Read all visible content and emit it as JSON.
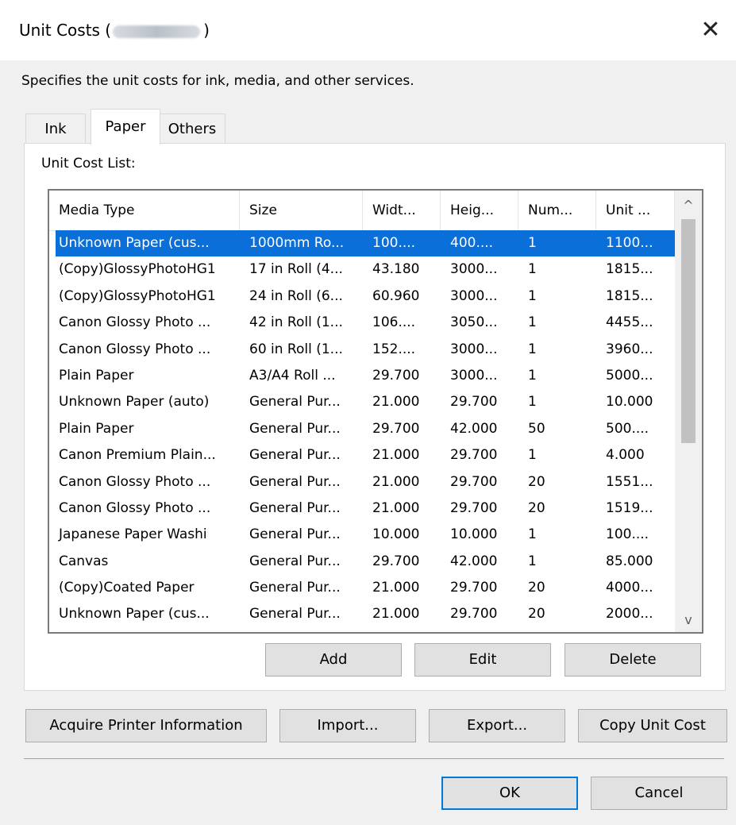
{
  "window": {
    "title_prefix": "Unit Costs (",
    "title_suffix": ")",
    "close_glyph": "✕"
  },
  "description": "Specifies the unit costs for ink, media, and other services.",
  "tabs": [
    {
      "label": "Ink",
      "active": false
    },
    {
      "label": "Paper",
      "active": true
    },
    {
      "label": "Others",
      "active": false
    }
  ],
  "list": {
    "label": "Unit Cost List:",
    "columns": [
      "Media Type",
      "Size",
      "Widt...",
      "Heig...",
      "Num...",
      "Unit ..."
    ],
    "rows": [
      [
        "Unknown Paper (cus...",
        "1000mm Ro...",
        "100....",
        "400....",
        "1",
        "1100..."
      ],
      [
        "(Copy)GlossyPhotoHG1",
        "17 in Roll (4...",
        "43.180",
        "3000...",
        "1",
        "1815..."
      ],
      [
        "(Copy)GlossyPhotoHG1",
        "24 in Roll (6...",
        "60.960",
        "3000...",
        "1",
        "1815..."
      ],
      [
        "Canon Glossy Photo ...",
        "42 in Roll (1...",
        "106....",
        "3050...",
        "1",
        "4455..."
      ],
      [
        "Canon Glossy Photo ...",
        "60 in Roll (1...",
        "152....",
        "3000...",
        "1",
        "3960..."
      ],
      [
        "Plain Paper",
        "A3/A4 Roll ...",
        "29.700",
        "3000...",
        "1",
        "5000..."
      ],
      [
        "Unknown Paper (auto)",
        "General Pur...",
        "21.000",
        "29.700",
        "1",
        "10.000"
      ],
      [
        "Plain Paper",
        "General Pur...",
        "29.700",
        "42.000",
        "50",
        "500...."
      ],
      [
        "Canon Premium Plain...",
        "General Pur...",
        "21.000",
        "29.700",
        "1",
        "4.000"
      ],
      [
        "Canon Glossy Photo ...",
        "General Pur...",
        "21.000",
        "29.700",
        "20",
        "1551..."
      ],
      [
        "Canon Glossy Photo ...",
        "General Pur...",
        "21.000",
        "29.700",
        "20",
        "1519..."
      ],
      [
        "Japanese Paper Washi",
        "General Pur...",
        "10.000",
        "10.000",
        "1",
        "100...."
      ],
      [
        "Canvas",
        "General Pur...",
        "29.700",
        "42.000",
        "1",
        "85.000"
      ],
      [
        "(Copy)Coated Paper",
        "General Pur...",
        "21.000",
        "29.700",
        "20",
        "4000..."
      ],
      [
        "Unknown Paper (cus...",
        "General Pur...",
        "21.000",
        "29.700",
        "20",
        "2000..."
      ]
    ],
    "selected_index": 0,
    "scroll_up_glyph": "^",
    "scroll_down_glyph": "v"
  },
  "list_buttons": {
    "add": "Add",
    "edit": "Edit",
    "delete": "Delete"
  },
  "action_buttons": {
    "acquire": "Acquire Printer Information",
    "import": "Import...",
    "export": "Export...",
    "copy": "Copy Unit Cost"
  },
  "footer_buttons": {
    "ok": "OK",
    "cancel": "Cancel"
  },
  "colors": {
    "selection": "#0a6fd8",
    "primary_border": "#0078d7"
  }
}
